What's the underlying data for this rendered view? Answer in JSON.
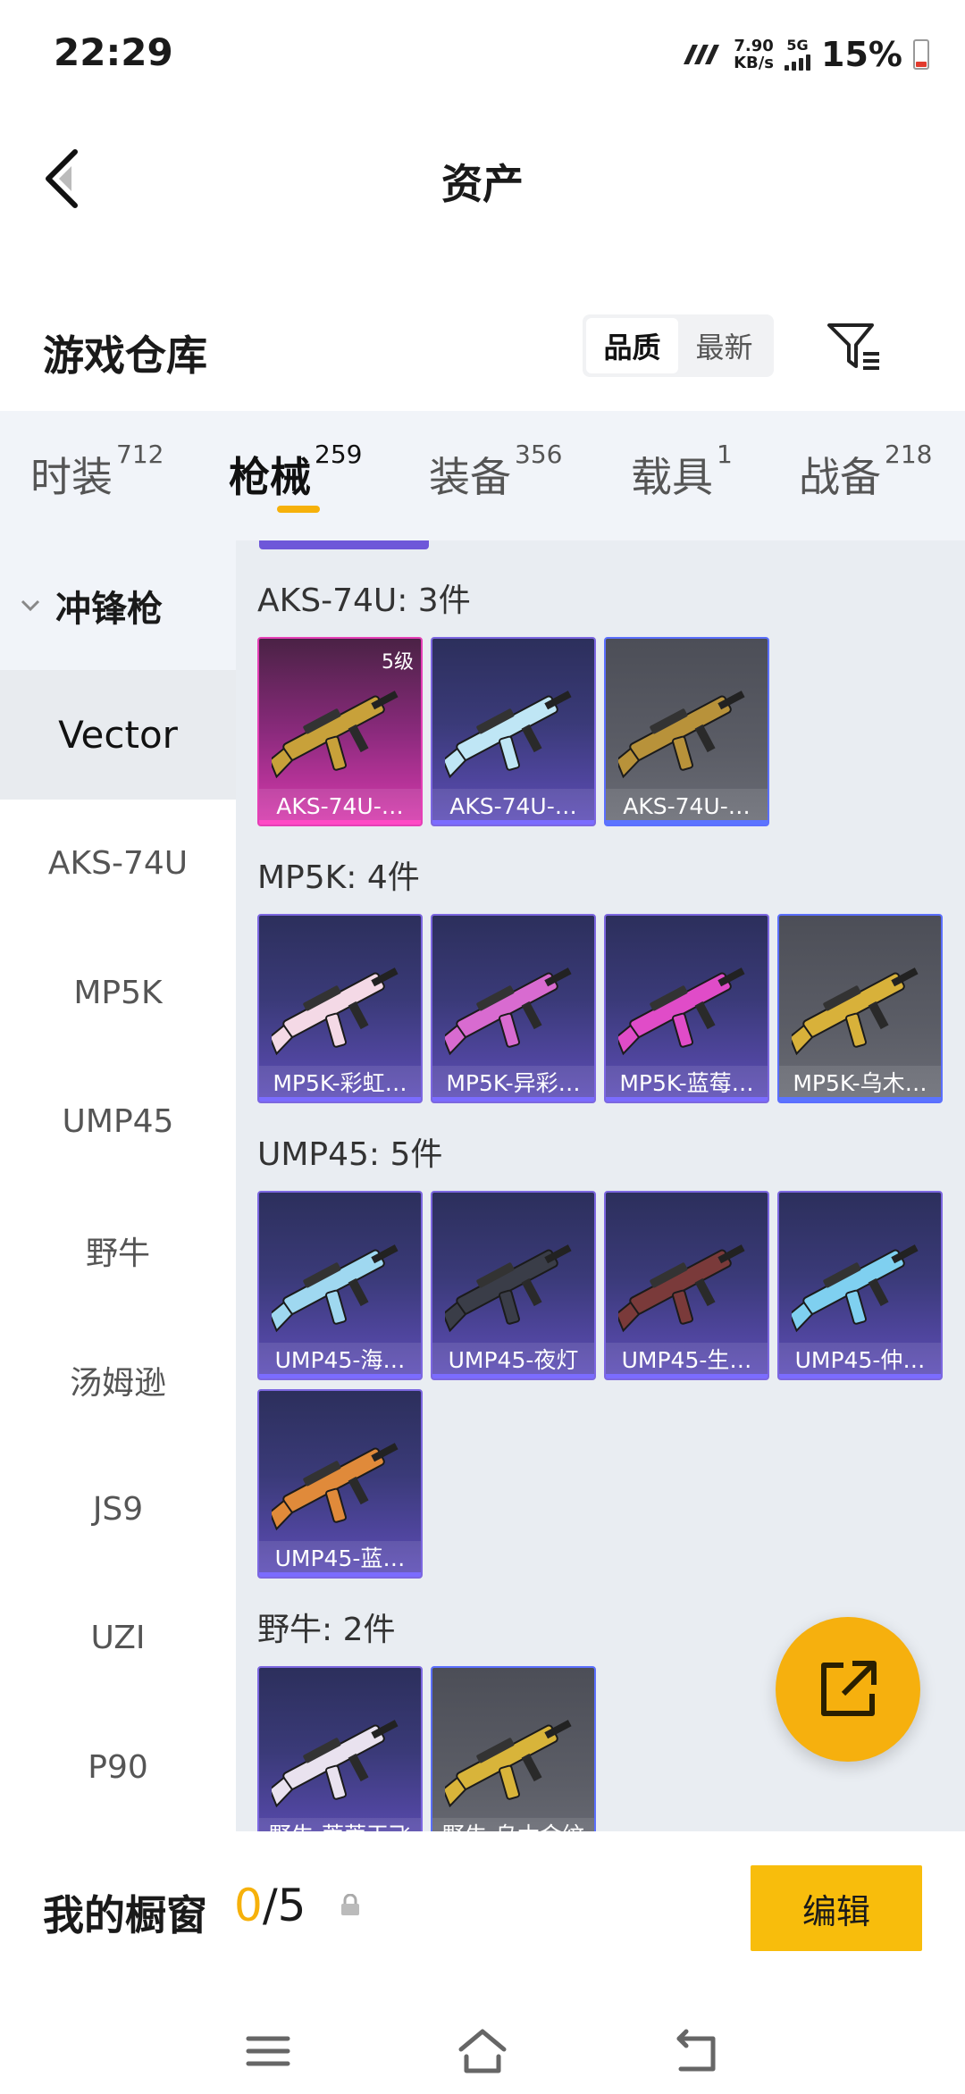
{
  "status_bar": {
    "time": "22:29",
    "net_speed_value": "7.90",
    "net_speed_unit": "KB/s",
    "network": "5G",
    "battery": "15%"
  },
  "header": {
    "title": "资产"
  },
  "warehouse": {
    "title": "游戏仓库",
    "sort_options": [
      "品质",
      "最新"
    ],
    "active_sort": "品质"
  },
  "tabs": [
    {
      "label": "时装",
      "count": "712"
    },
    {
      "label": "枪械",
      "count": "259",
      "active": true
    },
    {
      "label": "装备",
      "count": "356"
    },
    {
      "label": "载具",
      "count": "1"
    },
    {
      "label": "战备",
      "count": "218"
    }
  ],
  "sidebar": {
    "category": "冲锋枪",
    "items": [
      "Vector",
      "AKS-74U",
      "MP5K",
      "UMP45",
      "野牛",
      "汤姆逊",
      "JS9",
      "UZI",
      "P90"
    ],
    "active": "Vector"
  },
  "sections": [
    {
      "title": "AKS-74U: 3件",
      "items": [
        {
          "label": "AKS-74U-…",
          "rarity": "pink",
          "badge": "5级",
          "color": "#c8a13a"
        },
        {
          "label": "AKS-74U-…",
          "rarity": "purple",
          "color": "#bfe6f5"
        },
        {
          "label": "AKS-74U-…",
          "rarity": "grey",
          "color": "#b8923a"
        }
      ]
    },
    {
      "title": "MP5K: 4件",
      "items": [
        {
          "label": "MP5K-彩虹…",
          "rarity": "purple",
          "color": "#f4d9e6"
        },
        {
          "label": "MP5K-异彩…",
          "rarity": "purple",
          "color": "#d86bd0"
        },
        {
          "label": "MP5K-蓝莓…",
          "rarity": "purple",
          "color": "#e04cc8"
        },
        {
          "label": "MP5K-乌木…",
          "rarity": "grey",
          "color": "#d8b13a"
        }
      ]
    },
    {
      "title": "UMP45: 5件",
      "items": [
        {
          "label": "UMP45-海…",
          "rarity": "purple",
          "color": "#9fd8f0"
        },
        {
          "label": "UMP45-夜灯",
          "rarity": "purple",
          "color": "#3a3d48"
        },
        {
          "label": "UMP45-生…",
          "rarity": "purple",
          "color": "#7a3a3a"
        },
        {
          "label": "UMP45-仲…",
          "rarity": "purple",
          "color": "#7fd0f0"
        },
        {
          "label": "UMP45-蓝…",
          "rarity": "purple",
          "color": "#e08a3a"
        }
      ]
    },
    {
      "title": "野牛: 2件",
      "items": [
        {
          "label": "野牛-蒂蒂干飞",
          "rarity": "purple",
          "color": "#e9e2ef"
        },
        {
          "label": "野牛-乌木金纹",
          "rarity": "grey",
          "color": "#d8b43a"
        }
      ]
    }
  ],
  "showcase": {
    "label": "我的橱窗",
    "current": "0",
    "total": "/5",
    "edit_label": "编辑"
  },
  "colors": {
    "accent": "#f6b10b",
    "pink_rarity": "#e53fb6",
    "purple_rarity": "#7c67e0"
  }
}
